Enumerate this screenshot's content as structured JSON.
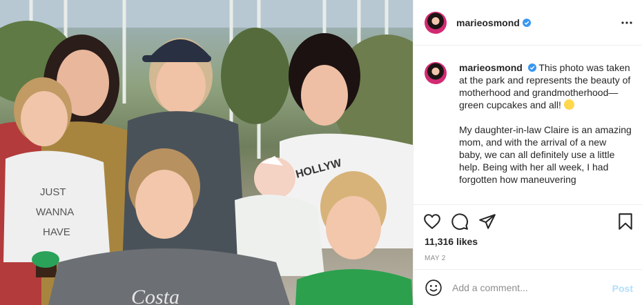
{
  "post": {
    "username": "marieosmond",
    "verified": true,
    "caption_paragraphs": [
      "This photo was taken at the park and represents the beauty of motherhood and grandmotherhood—green cupcakes and all!",
      "My daughter-in-law Claire is an amazing mom, and with the arrival of a new baby, we can all definitely use a little help. Being with her all week, I had forgotten how maneuvering"
    ],
    "likes": "11,316 likes",
    "date": "MAY 2"
  },
  "photo": {
    "shirt_text_1": "JUST",
    "shirt_text_2": "WANNA",
    "shirt_text_3": "HAVE",
    "shirt_text_4": "HOLLYW",
    "cap_text": "Costa"
  },
  "comment": {
    "placeholder": "Add a comment...",
    "post_label": "Post"
  },
  "colors": {
    "accent": "#0095f6",
    "post_disabled": "#b2dffc",
    "verified": "#3897f0"
  },
  "icons": [
    "more-options-icon",
    "verified-badge-icon",
    "heart-icon",
    "comment-icon",
    "share-icon",
    "bookmark-icon",
    "emoji-icon"
  ]
}
